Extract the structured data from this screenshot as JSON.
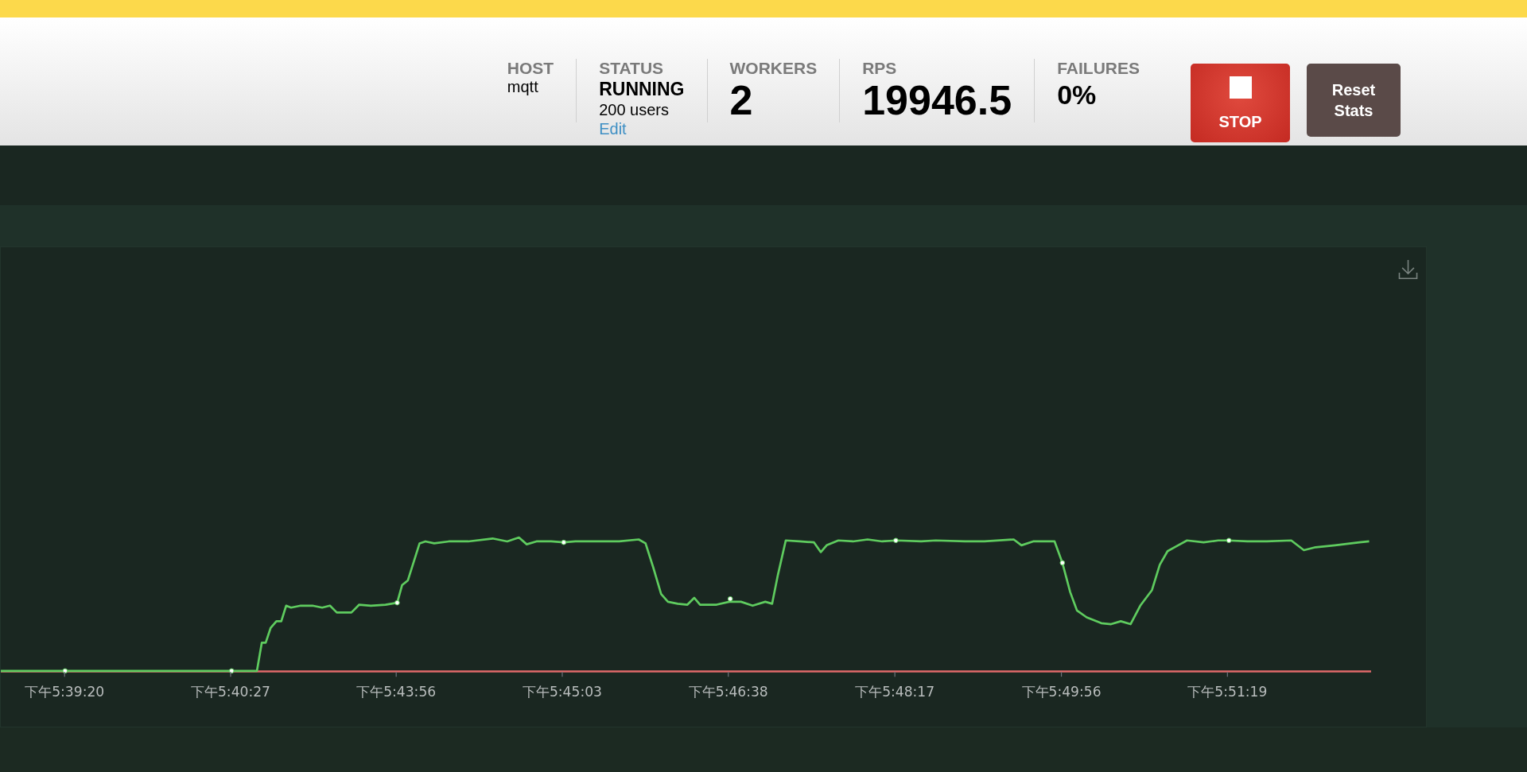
{
  "header": {
    "stats": [
      {
        "kind": "plain",
        "label": "HOST",
        "value": "mqtt"
      },
      {
        "kind": "status",
        "label": "STATUS",
        "value": "RUNNING",
        "detail": "200 users",
        "link": "Edit"
      },
      {
        "kind": "big",
        "label": "WORKERS",
        "value": "2"
      },
      {
        "kind": "big",
        "label": "RPS",
        "value": "19946.5"
      },
      {
        "kind": "medium",
        "label": "FAILURES",
        "value": "0%"
      }
    ],
    "buttons": [
      {
        "kind": "stop",
        "label": "STOP"
      },
      {
        "kind": "reset",
        "label": "Reset\nStats"
      }
    ]
  },
  "chart": {
    "x_labels": [
      "下午5:39:20",
      "下午5:40:27",
      "下午5:43:56",
      "下午5:45:03",
      "下午5:46:38",
      "下午5:48:17",
      "下午5:49:56",
      "下午5:51:19"
    ]
  }
}
